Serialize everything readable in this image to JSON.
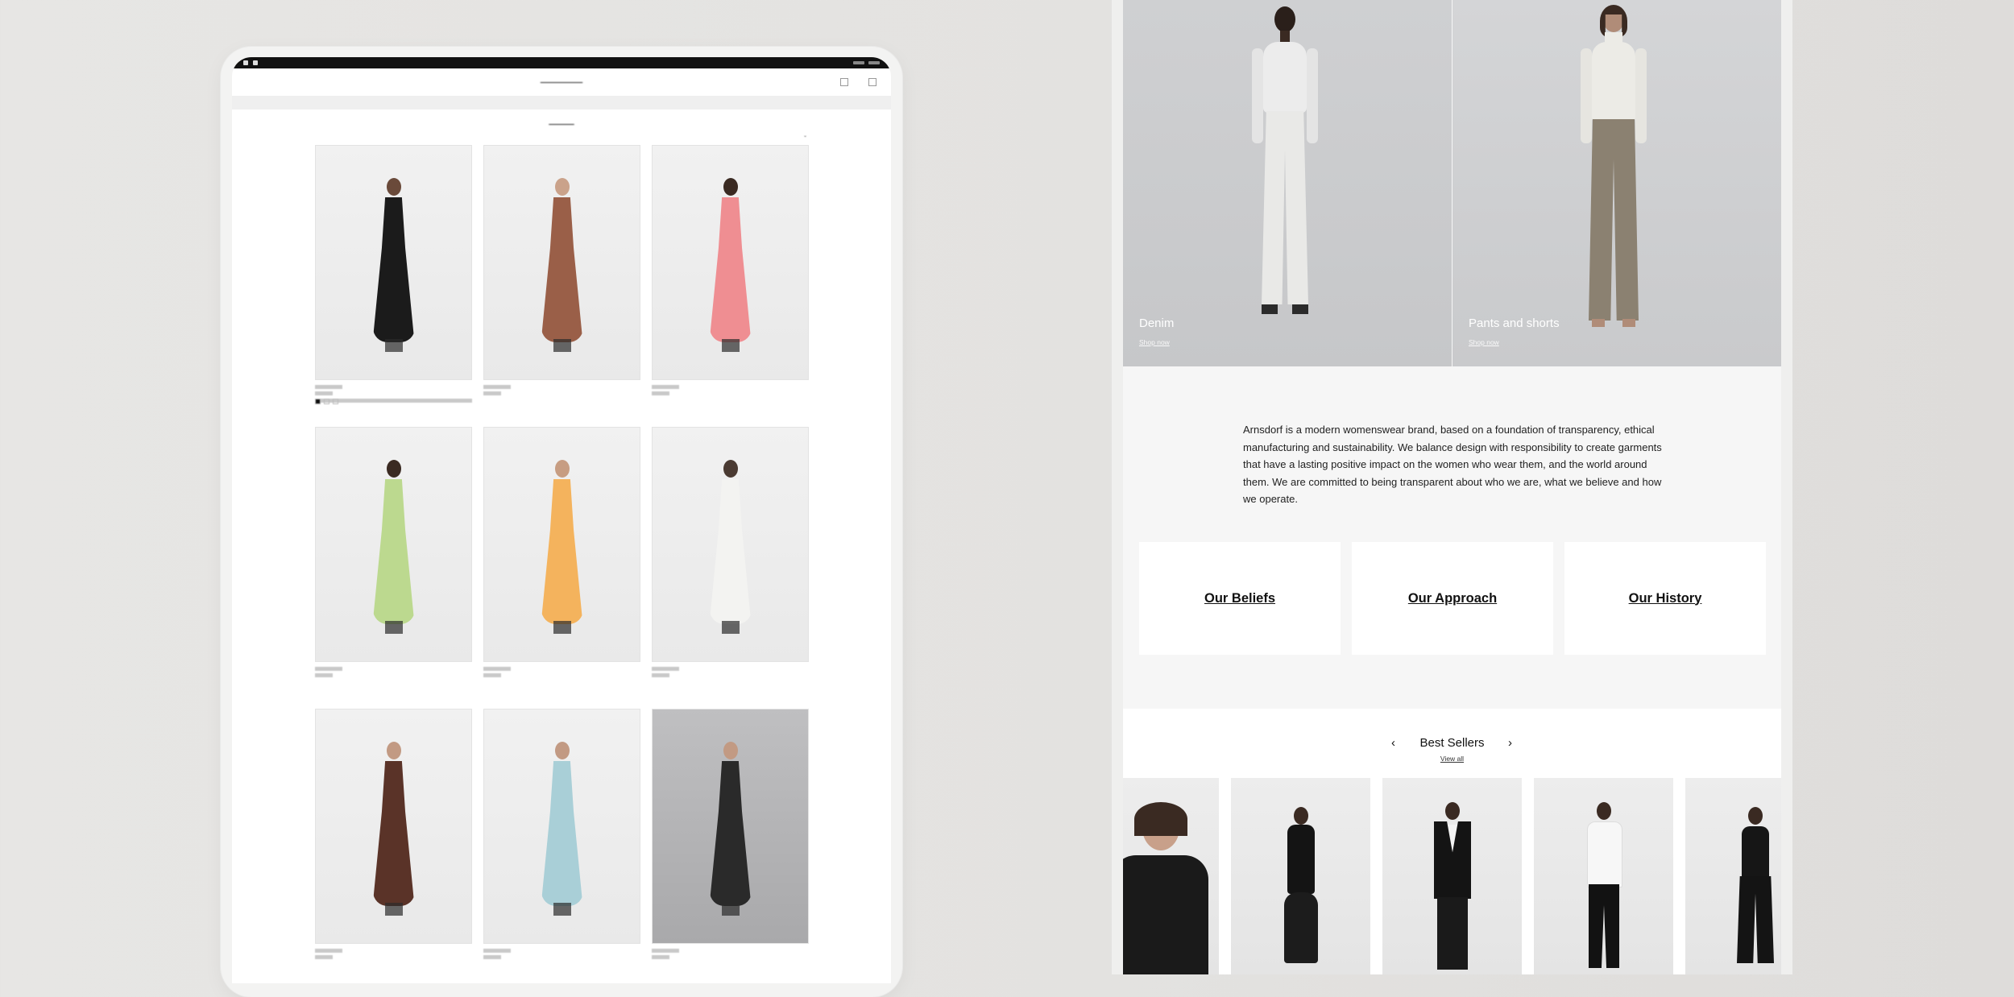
{
  "colors": {
    "page_bg": "#e5e4e2",
    "text": "#111111",
    "dress_black": "#1b1b1b",
    "dress_rust": "#9a5f48",
    "dress_pink": "#ef8e92",
    "dress_green": "#bcd98f",
    "dress_yellow": "#f4b35d",
    "coat_white": "#f3f3f1",
    "dress_brown_floral": "#5a3328",
    "dress_lightblue": "#a9cfd7",
    "dress_black_leather": "#2a2a2a"
  },
  "tablet": {
    "products": [
      {
        "color_key": "dress_black",
        "skin": "#6a4a3a",
        "has_swatches": true
      },
      {
        "color_key": "dress_rust",
        "skin": "#caa28a",
        "has_swatches": false
      },
      {
        "color_key": "dress_pink",
        "skin": "#3a2a22",
        "has_swatches": false
      },
      {
        "color_key": "dress_green",
        "skin": "#3a2a22",
        "has_swatches": false
      },
      {
        "color_key": "dress_yellow",
        "skin": "#c79d82",
        "has_swatches": false
      },
      {
        "color_key": "coat_white",
        "skin": "#4a3a32",
        "has_swatches": false
      },
      {
        "color_key": "dress_brown_floral",
        "skin": "#c29a83",
        "has_swatches": false
      },
      {
        "color_key": "dress_lightblue",
        "skin": "#c29a83",
        "has_swatches": false
      },
      {
        "color_key": "dress_black_leather",
        "skin": "#c29a83",
        "has_swatches": false
      }
    ]
  },
  "hero": {
    "tiles": [
      {
        "caption": "Denim",
        "cta": "Shop now"
      },
      {
        "caption": "Pants and shorts",
        "cta": "Shop now"
      }
    ]
  },
  "about": {
    "text": "Arnsdorf is a modern womenswear brand, based on a foundation of transparency, ethical manufacturing and sustainability. We balance design with responsibility to create garments that have a lasting positive impact on the women who wear them, and the world around them. We are committed to being transparent about who we are, what we believe and how we operate."
  },
  "links": {
    "beliefs": "Our Beliefs",
    "approach": "Our Approach",
    "history": "Our History"
  },
  "best_sellers": {
    "title": "Best Sellers",
    "view_all": "View all",
    "prev_icon": "‹",
    "next_icon": "›"
  }
}
